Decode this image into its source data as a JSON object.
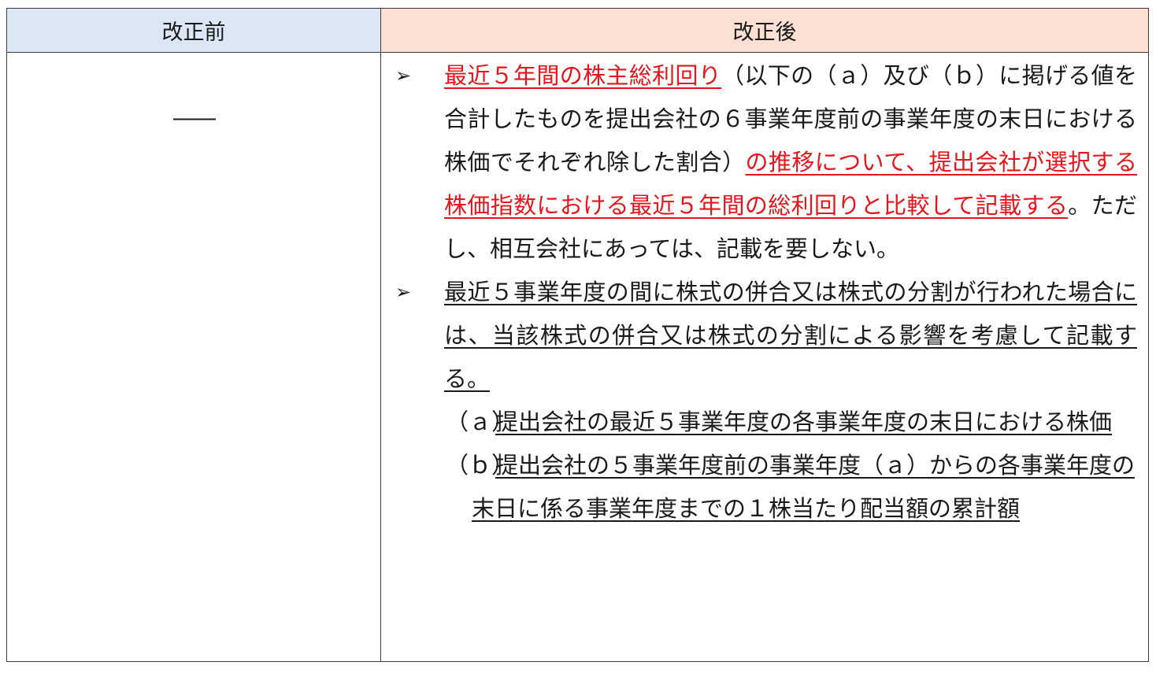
{
  "table": {
    "header_before": "改正前",
    "header_after": "改正後",
    "before_cell": "――",
    "bullet_icon": "arrowhead-bullet",
    "after": {
      "bullet1": {
        "mark": "➢",
        "red1": "最近５年間の株主総利回り",
        "plain1": "（以下の（ａ）及び（ｂ）に掲げる値を合計したものを提出会社の６事業年度前の事業年度の末日における株価でそれぞれ除した割合）",
        "red2": "の推移について、提出会社が選択する株価指数における最近５年間の総利回りと比較して記載する",
        "plain2": "。ただし、相互会社にあっては、記載を要しない。"
      },
      "bullet2": {
        "mark": "➢",
        "text": "最近５事業年度の間に株式の併合又は株式の分割が行われた場合には、当該株式の併合又は株式の分割による影響を考慮して記載する。"
      },
      "item_a": {
        "label": "（ａ）",
        "text": "提出会社の最近５事業年度の各事業年度の末日における株価"
      },
      "item_b": {
        "label": "（ｂ）",
        "text": "提出会社の５事業年度前の事業年度（ａ）からの各事業年度の末日に係る事業年度までの１株当たり配当額の累計額"
      }
    }
  },
  "colors": {
    "header_before_bg": "#dbe7f5",
    "header_after_bg": "#fce0d3",
    "highlight_red": "#e8141b"
  }
}
